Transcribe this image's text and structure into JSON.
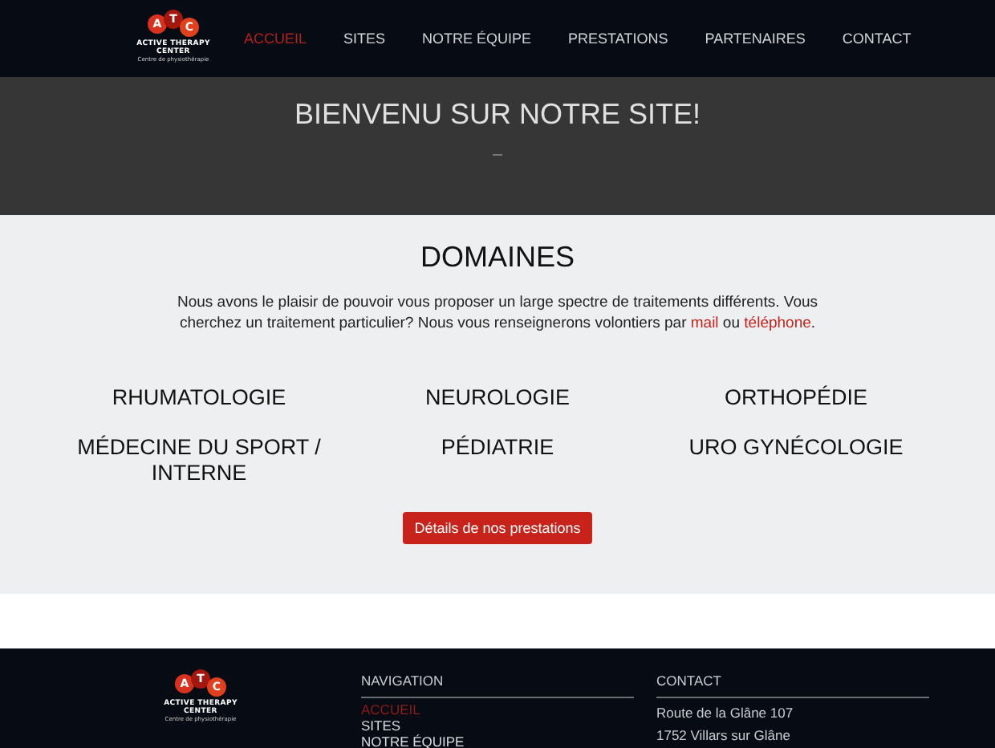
{
  "logo": {
    "letters": [
      "A",
      "T",
      "C"
    ],
    "name_line_1": "ACTIVE THERAPY",
    "name_line_2": "CENTER",
    "tagline": "Centre de physiothérapie"
  },
  "nav": [
    {
      "label": "ACCUEIL",
      "selected": true
    },
    {
      "label": "SITES",
      "selected": false
    },
    {
      "label": "NOTRE ÉQUIPE",
      "selected": false
    },
    {
      "label": "PRESTATIONS",
      "selected": false
    },
    {
      "label": "PARTENAIRES",
      "selected": false
    },
    {
      "label": "CONTACT",
      "selected": false
    }
  ],
  "hero": {
    "title": "BIENVENU SUR NOTRE SITE!"
  },
  "domains": {
    "title": "DOMAINES",
    "intro": [
      {
        "kind": "text",
        "text": "Nous avons le plaisir de pouvoir vous proposer un large spectre de traitements différents. Vous cherchez un traitement particulier? Nous vous renseignerons volontiers par "
      },
      {
        "kind": "link",
        "text": "mail"
      },
      {
        "kind": "text",
        "text": " ou "
      },
      {
        "kind": "link",
        "text": "téléphone"
      },
      {
        "kind": "text",
        "text": "."
      }
    ],
    "items": [
      "RHUMATOLOGIE",
      "NEUROLOGIE",
      "ORTHOPÉDIE",
      "MÉDECINE DU SPORT / INTERNE",
      "PÉDIATRIE",
      "URO GYNÉCOLOGIE"
    ],
    "button": "Détails de nos prestations"
  },
  "footer": {
    "logo": {
      "letters": [
        "A",
        "T",
        "C"
      ],
      "name_line_1": "ACTIVE THERAPY",
      "name_line_2": "CENTER",
      "tagline": "Centre de physiothérapie"
    },
    "navigation": {
      "title": "NAVIGATION",
      "items": [
        {
          "label": "ACCUEIL",
          "selected": true
        },
        {
          "label": "SITES",
          "selected": false
        },
        {
          "label": "NOTRE ÉQUIPE",
          "selected": false
        }
      ]
    },
    "contact": {
      "title": "CONTACT",
      "lines": [
        "Route de la Glâne 107",
        "1752 Villars sur Glâne"
      ]
    }
  }
}
